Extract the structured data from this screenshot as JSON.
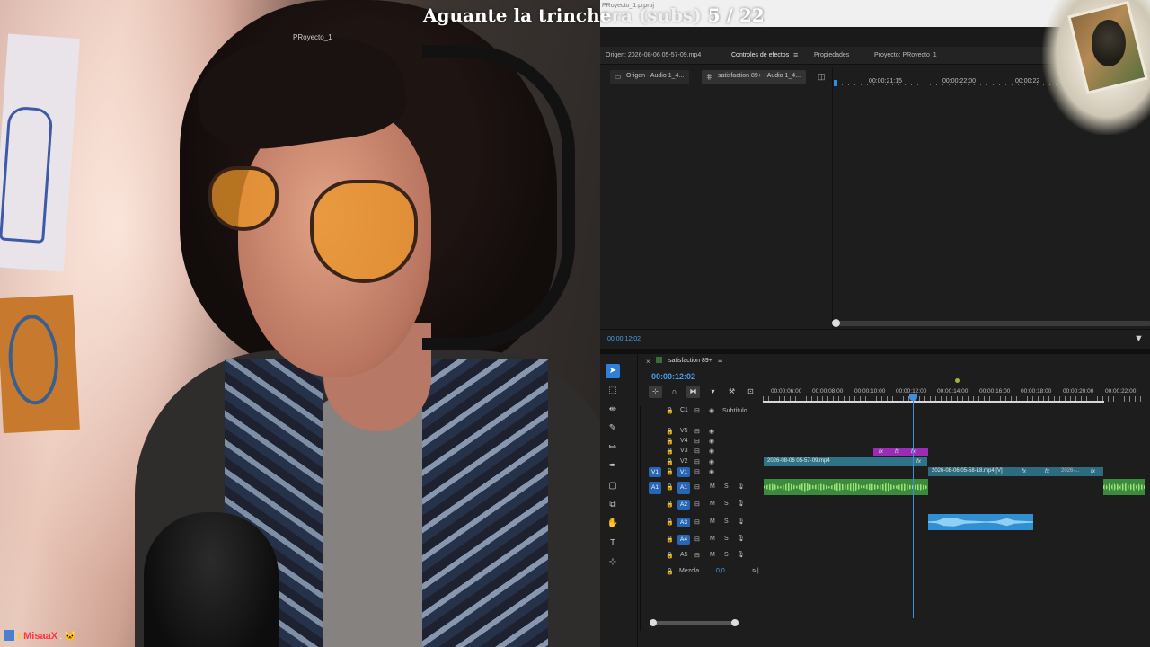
{
  "overlay": {
    "stream_title": "Aguante la trinchera (subs) 5 / 22",
    "stream_title_main": "Aguante la trinche",
    "stream_title_dim": "ra (subs)",
    "stream_title_count": " 5 / 22",
    "chat": {
      "badge_number": "1",
      "username": "MisaaX",
      "separator": ":",
      "message": "🐱"
    }
  },
  "app": {
    "window_file": "PRoyecto_1.prproj",
    "project_title": "PRoyecto_1",
    "panel_tabs": [
      {
        "label": "Origen: 2026-08-06 05-57-09.mp4"
      },
      {
        "label": "Controles de efectos"
      },
      {
        "label": "Propiedades"
      },
      {
        "label": "Proyecto: PRoyecto_1"
      }
    ],
    "tab_menu_icon": "≡",
    "effect_subtabs": [
      {
        "label": "Origen - Audio 1_4...",
        "icon": "film-icon"
      },
      {
        "label": "satisfaction 89+ - Audio 1_4...",
        "icon": "sequence-icon"
      }
    ],
    "effect_ruler": [
      "00:00:21:15",
      "00:00:22:00",
      "00:00:22"
    ],
    "effect_timecode": "00:00:12:02",
    "timeline": {
      "sequence_name": "satisfaction 89+",
      "timecode": "00:00:12:02",
      "ruler": [
        "00:00:06:00",
        "00:00:08:00",
        "00:00:10:00",
        "00:00:12:00",
        "00:00:14:00",
        "00:00:16:00",
        "00:00:18:00",
        "00:00:20:00",
        "00:00:22:00"
      ],
      "caption_track": {
        "id": "C1",
        "name": "Subtítulo"
      },
      "video_tracks": [
        "V5",
        "V4",
        "V3",
        "V2",
        "V1"
      ],
      "source_video_target": "V1",
      "audio_tracks": [
        "A1",
        "A2",
        "A3",
        "A4",
        "A5"
      ],
      "source_audio_target": "A1",
      "mix": {
        "label": "Mezcla",
        "value": "0,0"
      },
      "track_toggles": {
        "mute": "M",
        "solo": "S"
      },
      "clips": {
        "v2": "2026-08-06 05-57-09.mp4",
        "v1_a": "2026-08-06 05-58-18.mp4 [V]",
        "v1_b": "2026-...",
        "fx": "fx"
      }
    }
  },
  "colors": {
    "accent_blue": "#2d7fd9",
    "timecode_blue": "#4d9eea",
    "video_clip": "#2e7386",
    "audio_clip_green": "#3c8a3e",
    "audio_clip_blue": "#2f8fd1",
    "adjustment_clip": "#9b2cb4",
    "chat_username": "#ff3344"
  }
}
